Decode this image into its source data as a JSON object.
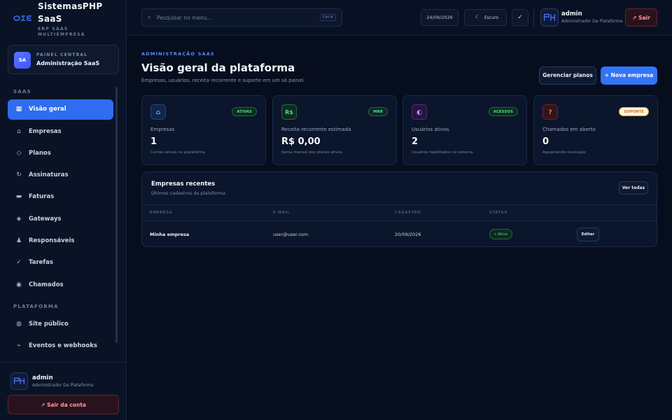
{
  "brand": {
    "title": "SistemasPHP SaaS",
    "subtitle": "ERP SAAS MULTIEMPRESA"
  },
  "panel": {
    "small": "PAINEL CENTRAL",
    "name": "Administração SaaS",
    "avatar": "SA"
  },
  "nav": {
    "section_saas": "SAAS",
    "section_platform": "PLATAFORMA",
    "items": [
      {
        "label": "Visão geral",
        "icon": "grid-icon",
        "glyph": "▦"
      },
      {
        "label": "Empresas",
        "icon": "home-icon",
        "glyph": "⌂"
      },
      {
        "label": "Planos",
        "icon": "diamond-icon",
        "glyph": "◇"
      },
      {
        "label": "Assinaturas",
        "icon": "refresh-icon",
        "glyph": "↻"
      },
      {
        "label": "Faturas",
        "icon": "card-icon",
        "glyph": "▬"
      },
      {
        "label": "Gateways",
        "icon": "gateway-icon",
        "glyph": "◈"
      },
      {
        "label": "Responsáveis",
        "icon": "user-icon",
        "glyph": "♟"
      },
      {
        "label": "Tarefas",
        "icon": "check-icon",
        "glyph": "✓"
      },
      {
        "label": "Chamados",
        "icon": "support-icon",
        "glyph": "◉"
      },
      {
        "label": "Site público",
        "icon": "globe-icon",
        "glyph": "◍"
      },
      {
        "label": "Eventos e webhooks",
        "icon": "webhook-icon",
        "glyph": "⌁"
      }
    ]
  },
  "sidebar_user": {
    "name": "admin",
    "role": "Administrador Da Plataforma",
    "logout": "↗ Sair da conta"
  },
  "topbar": {
    "search_placeholder": "Pesquisar no menu...",
    "search_shortcut": "Ctrl K",
    "date": "24/09/2026",
    "theme_label": "Escuro",
    "theme_icon": "☾",
    "check_icon": "✓",
    "user_name": "admin",
    "user_role": "Administrador Da Plataforma",
    "exit_label": "↗ Sair"
  },
  "page": {
    "eyebrow": "ADMINISTRAÇÃO SAAS",
    "title": "Visão geral da plataforma",
    "lead": "Empresas, usuários, receita recorrente e suporte em um só painel.",
    "btn_manage": "Gerenciar planos",
    "btn_new": "+ Nova empresa"
  },
  "cards": [
    {
      "badge": "ATIVAS",
      "label": "Empresas",
      "value": "1",
      "hint": "Contas ativas na plataforma",
      "glyph": "⌂",
      "icon": "building-icon",
      "accent": "#3b82f6"
    },
    {
      "badge": "MRR",
      "label": "Receita recorrente estimada",
      "value": "R$ 0,00",
      "hint": "Soma mensal dos planos ativos",
      "glyph": "R$",
      "icon": "currency-icon",
      "accent": "#22c55e"
    },
    {
      "badge": "ACESSOS",
      "label": "Usuários ativos",
      "value": "2",
      "hint": "Usuários habilitados no sistema",
      "glyph": "◐",
      "icon": "users-icon",
      "accent": "#a855f7"
    },
    {
      "badge": "SUPORTE",
      "label": "Chamados em aberto",
      "value": "0",
      "hint": "Aguardando resolução",
      "glyph": "?",
      "icon": "help-icon",
      "accent": "#f87171"
    }
  ],
  "recent": {
    "title": "Empresas recentes",
    "subtitle": "Últimos cadastros da plataforma",
    "view_all": "Ver todas",
    "columns": [
      "EMPRESA",
      "E-MAIL",
      "CADASTRO",
      "STATUS"
    ],
    "rows": [
      {
        "company": "Minha empresa",
        "email": "user@user.com",
        "date": "20/09/2026",
        "status": "• Ativo",
        "action": "Editar"
      }
    ]
  }
}
